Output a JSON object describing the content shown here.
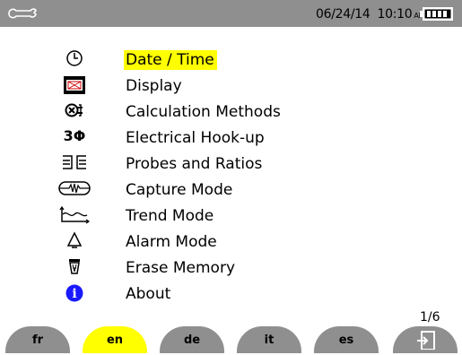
{
  "status": {
    "date": "06/24/14",
    "time": "10:10",
    "ampm": "AM",
    "icons": {
      "left": "wrench-icon",
      "right": "battery-icon"
    },
    "colors": {
      "bar": "#8f8f8f"
    }
  },
  "menu": {
    "selected_index": 0,
    "highlight_color": "#ffff00",
    "items": [
      {
        "label": "Date / Time",
        "icon": "clock-icon"
      },
      {
        "label": "Display",
        "icon": "display-icon"
      },
      {
        "label": "Calculation Methods",
        "icon": "calculation-icon"
      },
      {
        "label": "Electrical Hook-up",
        "icon": "three-phase-icon"
      },
      {
        "label": "Probes and Ratios",
        "icon": "probes-icon"
      },
      {
        "label": "Capture Mode",
        "icon": "capture-icon"
      },
      {
        "label": "Trend Mode",
        "icon": "trend-icon"
      },
      {
        "label": "Alarm Mode",
        "icon": "alarm-icon"
      },
      {
        "label": "Erase Memory",
        "icon": "erase-icon"
      },
      {
        "label": "About",
        "icon": "info-icon"
      }
    ]
  },
  "three_phase_text": "3Φ",
  "info_text": "i",
  "page_indicator": "1/6",
  "languages": [
    {
      "code": "fr",
      "active": false
    },
    {
      "code": "en",
      "active": true
    },
    {
      "code": "de",
      "active": false
    },
    {
      "code": "it",
      "active": false
    },
    {
      "code": "es",
      "active": false
    }
  ]
}
